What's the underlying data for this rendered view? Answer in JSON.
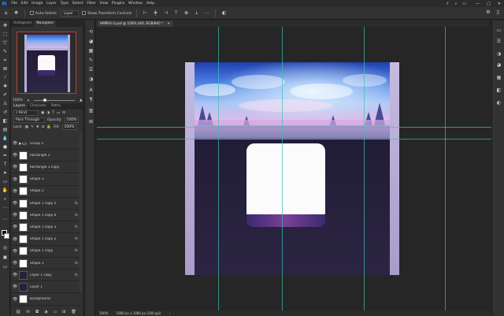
{
  "menubar": {
    "logo": "Ps",
    "items": [
      "File",
      "Edit",
      "Image",
      "Layer",
      "Type",
      "Select",
      "Filter",
      "View",
      "Plugins",
      "Window",
      "Help"
    ],
    "window_controls": [
      "—",
      "▢",
      "✕"
    ]
  },
  "options": {
    "auto_select_label": "Auto-Select:",
    "auto_select_value": "Layer",
    "transform_label": "Show Transform Controls"
  },
  "navigator": {
    "tabs": [
      "Histogram",
      "Navigator"
    ],
    "zoom": "100%"
  },
  "layers_panel": {
    "tabs": [
      "Layers",
      "Channels",
      "Paths"
    ],
    "filter_value": "Kind",
    "blend_mode": "Pass Through",
    "opacity_label": "Opacity:",
    "opacity_value": "100%",
    "lock_label": "Lock:",
    "fill_label": "Fill:",
    "fill_value": "100%",
    "layers": [
      {
        "name": "Group 2",
        "type": "folder",
        "fx": ""
      },
      {
        "name": "Rectangle 3",
        "type": "thumb",
        "fx": ""
      },
      {
        "name": "Rectangle 3 copy",
        "type": "thumb",
        "fx": ""
      },
      {
        "name": "Shape 3",
        "type": "thumb",
        "fx": ""
      },
      {
        "name": "Shape 2",
        "type": "thumb",
        "fx": ""
      },
      {
        "name": "Shape 1 copy 5",
        "type": "thumb",
        "fx": "fx"
      },
      {
        "name": "Shape 1 copy 4",
        "type": "thumb",
        "fx": "fx"
      },
      {
        "name": "Shape 1 copy 3",
        "type": "thumb",
        "fx": "fx"
      },
      {
        "name": "Shape 1 copy 2",
        "type": "thumb",
        "fx": "fx"
      },
      {
        "name": "Shape 1 copy",
        "type": "thumb",
        "fx": "fx"
      },
      {
        "name": "Shape 1",
        "type": "thumb",
        "fx": "fx"
      },
      {
        "name": "Layer 1 copy",
        "type": "dark",
        "fx": "fx"
      },
      {
        "name": "Layer 1",
        "type": "dark",
        "fx": ""
      },
      {
        "name": "Background",
        "type": "thumb",
        "fx": "",
        "italic": true
      }
    ]
  },
  "document": {
    "tab_title": "HMPEX-3.psd @ 100% (HD, RGB/8#) *",
    "close_icon": "✕"
  },
  "status": {
    "zoom": "100%",
    "dimensions": "1080 px x 1080 px (300 ppi)"
  },
  "colors": {
    "accent": "#31a8ff",
    "guide": "#3fbfb0",
    "canvas_dark": "#27213a",
    "lavender": "#b6a9d3"
  }
}
